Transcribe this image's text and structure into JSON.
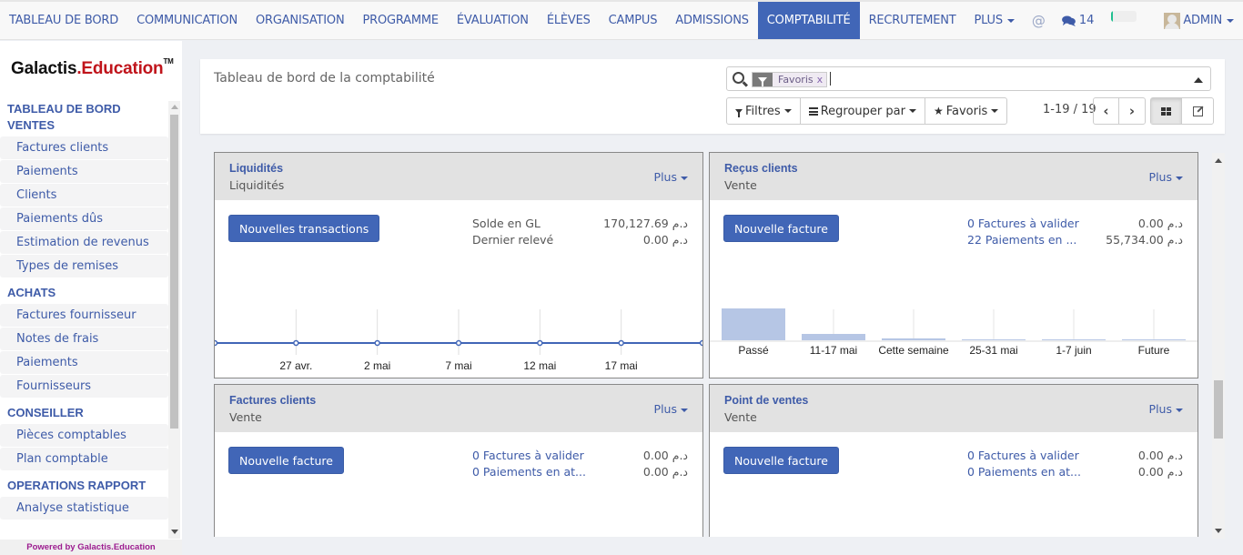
{
  "topnav": {
    "items": [
      {
        "label": "TABLEAU DE BORD",
        "active": false
      },
      {
        "label": "COMMUNICATION",
        "active": false
      },
      {
        "label": "ORGANISATION",
        "active": false
      },
      {
        "label": "PROGRAMME",
        "active": false
      },
      {
        "label": "ÉVALUATION",
        "active": false
      },
      {
        "label": "ÉLÈVES",
        "active": false
      },
      {
        "label": "CAMPUS",
        "active": false
      },
      {
        "label": "ADMISSIONS",
        "active": false
      },
      {
        "label": "COMPTABILITÉ",
        "active": true
      },
      {
        "label": "RECRUTEMENT",
        "active": false
      }
    ],
    "more_label": "PLUS",
    "mention_icon": "@",
    "messages_count": "14",
    "progress": 0.05,
    "user_label": "ADMIN"
  },
  "sidebar": {
    "logo_main": "Galactis",
    "logo_accent": ".Education",
    "logo_tm": "TM",
    "sections": [
      {
        "title": "TABLEAU DE BORD VENTES",
        "items": [
          "Factures clients",
          "Paiements",
          "Clients",
          "Paiements dûs",
          "Estimation de revenus",
          "Types de remises"
        ]
      },
      {
        "title": "ACHATS",
        "items": [
          "Factures fournisseur",
          "Notes de frais",
          "Paiements",
          "Fournisseurs"
        ]
      },
      {
        "title": "CONSEILLER",
        "items": [
          "Pièces comptables",
          "Plan comptable"
        ]
      },
      {
        "title": "OPERATIONS RAPPORT",
        "items": [
          "Analyse statistique"
        ]
      }
    ],
    "powered_by": "Powered by Galactis.Education"
  },
  "control_panel": {
    "title": "Tableau de bord de la comptabilité",
    "facet_label": "Favoris",
    "facet_remove": "x",
    "filters_label": "Filtres",
    "groupby_label": "Regrouper par",
    "favorites_label": "Favoris",
    "pager": "1-19 / 19",
    "prev": "‹",
    "next": "›"
  },
  "cards": [
    {
      "title": "Liquidités",
      "subtitle": "Liquidités",
      "more": "Plus",
      "button": "Nouvelles transactions",
      "rows": [
        {
          "label": "Solde en GL",
          "value": "170,127.69 د.م",
          "link": false
        },
        {
          "label": "Dernier relevé",
          "value": "0.00 د.م",
          "link": false
        }
      ]
    },
    {
      "title": "Reçus clients",
      "subtitle": "Vente",
      "more": "Plus",
      "button": "Nouvelle facture",
      "rows": [
        {
          "label": "0 Factures à valider",
          "value": "0.00 د.م",
          "link": true
        },
        {
          "label": "22 Paiements en ...",
          "value": "55,734.00 د.م",
          "link": true
        }
      ]
    },
    {
      "title": "Factures clients",
      "subtitle": "Vente",
      "more": "Plus",
      "button": "Nouvelle facture",
      "rows": [
        {
          "label": "0 Factures à valider",
          "value": "0.00 د.م",
          "link": true
        },
        {
          "label": "0 Paiements en at...",
          "value": "0.00 د.م",
          "link": true
        }
      ]
    },
    {
      "title": "Point de ventes",
      "subtitle": "Vente",
      "more": "Plus",
      "button": "Nouvelle facture",
      "rows": [
        {
          "label": "0 Factures à valider",
          "value": "0.00 د.م",
          "link": true
        },
        {
          "label": "0 Paiements en at...",
          "value": "0.00 د.م",
          "link": true
        }
      ]
    }
  ],
  "chart_data": [
    {
      "type": "line",
      "title": "Liquidités",
      "x": [
        "",
        "27 avr.",
        "2 mai",
        "7 mai",
        "12 mai",
        "17 mai",
        ""
      ],
      "values": [
        0,
        0,
        0,
        0,
        0,
        0,
        0
      ],
      "color": "#4166b7",
      "grid": true
    },
    {
      "type": "bar",
      "title": "Reçus clients",
      "categories": [
        "Passé",
        "11-17 mai",
        "Cette semaine",
        "25-31 mai",
        "1-7 juin",
        "Future"
      ],
      "values": [
        100,
        20,
        6,
        1,
        1,
        1
      ],
      "color": "#b6c6e5",
      "grid": true
    }
  ]
}
